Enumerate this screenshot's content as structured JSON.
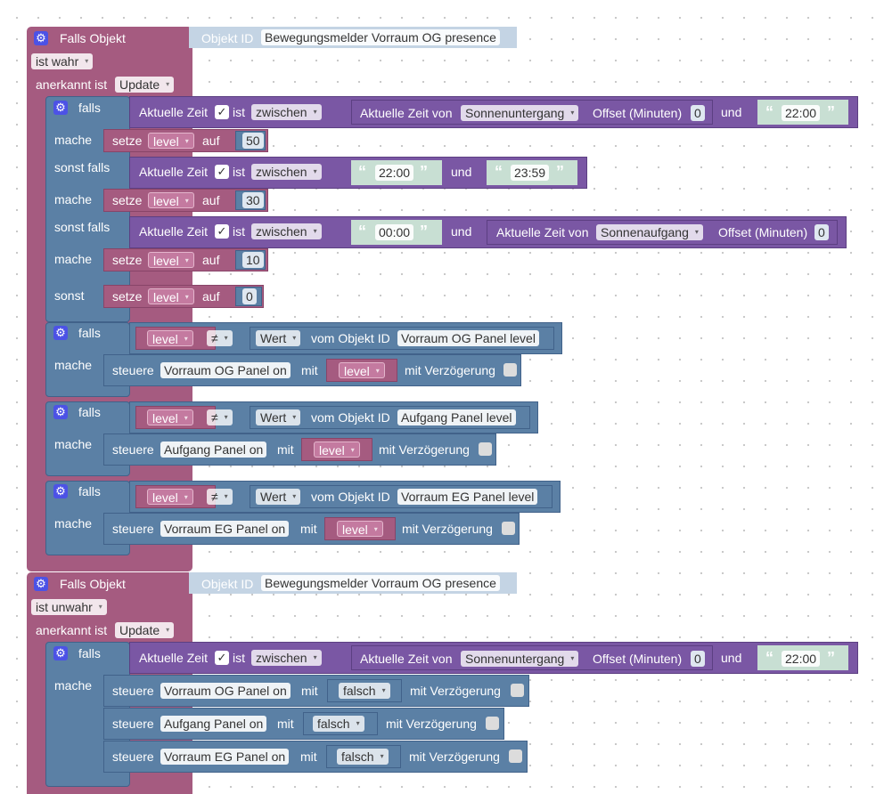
{
  "trigger1": {
    "title": "Falls Objekt",
    "objid_label": "Objekt ID",
    "objid_value": "Bewegungsmelder Vorraum OG presence",
    "condition": "ist wahr",
    "ack_label": "anerkannt ist",
    "ack_value": "Update"
  },
  "trigger2": {
    "title": "Falls Objekt",
    "objid_label": "Objekt ID",
    "objid_value": "Bewegungsmelder Vorraum OG presence",
    "condition": "ist unwahr",
    "ack_label": "anerkannt ist",
    "ack_value": "Update"
  },
  "words": {
    "falls": "falls",
    "mache": "mache",
    "sonst_falls": "sonst falls",
    "sonst": "sonst",
    "aktuelle_zeit": "Aktuelle Zeit",
    "check": "✓",
    "ist": "ist",
    "zwischen": "zwischen",
    "und": "und",
    "aktuelle_zeit_von": "Aktuelle Zeit von",
    "offset": "Offset (Minuten)",
    "setze": "setze",
    "auf": "auf",
    "level": "level",
    "neq": "≠",
    "wert": "Wert",
    "vom_objekt_id": "vom Objekt ID",
    "steuere": "steuere",
    "mit": "mit",
    "mit_verzoegerung": "mit Verzögerung",
    "falsch": "falsch",
    "quote_open": "“",
    "quote_close": "”",
    "arrow": "▾"
  },
  "block1": {
    "if1": {
      "sun": "Sonnenuntergang",
      "offset": "0",
      "time": "22:00",
      "set": "50"
    },
    "if2": {
      "t1": "22:00",
      "t2": "23:59",
      "set": "30"
    },
    "if3": {
      "t1": "00:00",
      "sun": "Sonnenaufgang",
      "offset": "0",
      "set": "10"
    },
    "else": {
      "set": "0"
    },
    "panels": [
      {
        "obj": "Vorraum OG Panel level",
        "ctrl": "Vorraum OG Panel on"
      },
      {
        "obj": "Aufgang Panel level",
        "ctrl": "Aufgang Panel on"
      },
      {
        "obj": "Vorraum EG Panel level",
        "ctrl": "Vorraum EG Panel on"
      }
    ]
  },
  "block2": {
    "if1": {
      "sun": "Sonnenuntergang",
      "offset": "0",
      "time": "22:00"
    },
    "ctrls": [
      {
        "obj": "Vorraum OG Panel on",
        "val": "falsch"
      },
      {
        "obj": "Aufgang Panel on",
        "val": "falsch"
      },
      {
        "obj": "Vorraum EG Panel on",
        "val": "falsch"
      }
    ]
  },
  "colors": {
    "trigger": "#a55b80",
    "logic": "#5b80a5",
    "time": "#7a57a4",
    "text": "#c8dfd3",
    "gear": "#4c52e6"
  }
}
